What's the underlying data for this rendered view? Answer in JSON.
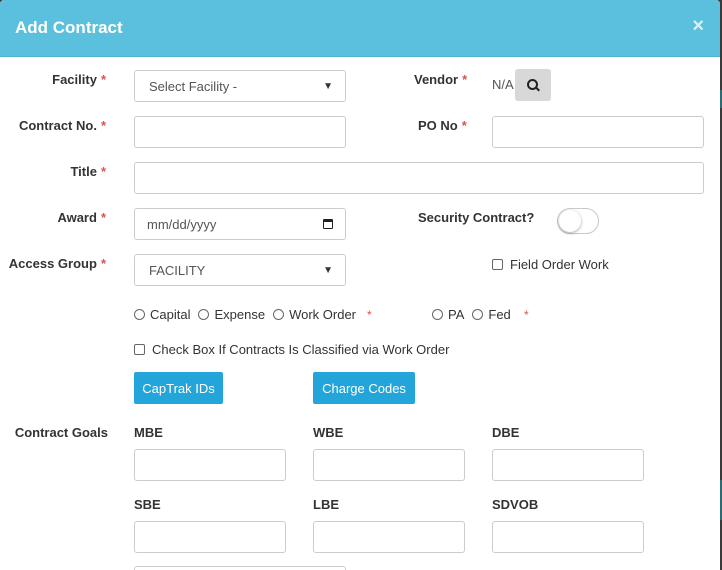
{
  "modal": {
    "title": "Add Contract",
    "close_symbol": "×"
  },
  "fields": {
    "facility": {
      "label": "Facility",
      "value": "Select Facility -"
    },
    "vendor": {
      "label": "Vendor",
      "value": "N/A"
    },
    "contract_no": {
      "label": "Contract No.",
      "value": ""
    },
    "po_no": {
      "label": "PO No",
      "value": ""
    },
    "title": {
      "label": "Title",
      "value": ""
    },
    "award": {
      "label": "Award",
      "placeholder": "mm/dd/yyyy"
    },
    "security_contract": {
      "label": "Security Contract?",
      "checked": false
    },
    "access_group": {
      "label": "Access Group",
      "value": "FACILITY"
    },
    "field_order_work": {
      "label": "Field Order Work",
      "checked": false
    }
  },
  "required_marker": "*",
  "funding_types": [
    "Capital",
    "Expense",
    "Work Order"
  ],
  "funding_sources": [
    "PA",
    "Fed"
  ],
  "work_order_check": {
    "label": "Check Box If Contracts Is Classified via Work Order",
    "checked": false
  },
  "buttons": {
    "captrak": "CapTrak IDs",
    "charge_codes": "Charge Codes"
  },
  "contract_goals": {
    "label": "Contract Goals",
    "goals": [
      "MBE",
      "WBE",
      "DBE",
      "SBE",
      "LBE",
      "SDVOB"
    ]
  },
  "colors": {
    "header": "#5bc0de",
    "button": "#23a5da",
    "required": "#d9534f"
  }
}
